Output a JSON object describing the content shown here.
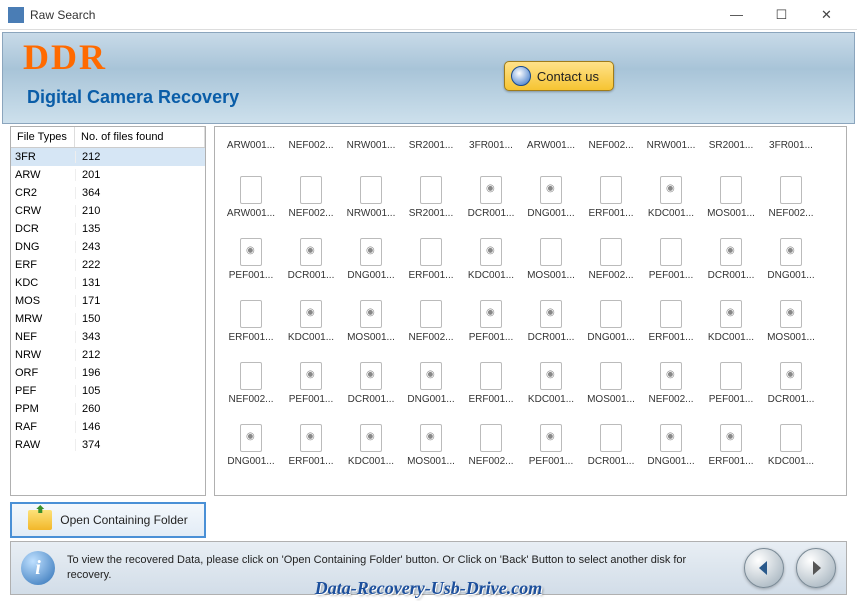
{
  "window": {
    "title": "Raw Search"
  },
  "header": {
    "logo": "DDR",
    "subtitle": "Digital Camera Recovery",
    "contact_label": "Contact us"
  },
  "left": {
    "col1": "File Types",
    "col2": "No. of files found",
    "rows": [
      {
        "t": "3FR",
        "n": "212"
      },
      {
        "t": "ARW",
        "n": "201"
      },
      {
        "t": "CR2",
        "n": "364"
      },
      {
        "t": "CRW",
        "n": "210"
      },
      {
        "t": "DCR",
        "n": "135"
      },
      {
        "t": "DNG",
        "n": "243"
      },
      {
        "t": "ERF",
        "n": "222"
      },
      {
        "t": "KDC",
        "n": "131"
      },
      {
        "t": "MOS",
        "n": "171"
      },
      {
        "t": "MRW",
        "n": "150"
      },
      {
        "t": "NEF",
        "n": "343"
      },
      {
        "t": "NRW",
        "n": "212"
      },
      {
        "t": "ORF",
        "n": "196"
      },
      {
        "t": "PEF",
        "n": "105"
      },
      {
        "t": "PPM",
        "n": "260"
      },
      {
        "t": "RAF",
        "n": "146"
      },
      {
        "t": "RAW",
        "n": "374"
      }
    ],
    "open_label": "Open Containing Folder"
  },
  "grid": {
    "row0": [
      "ARW001...",
      "NEF002...",
      "NRW001...",
      "SR2001...",
      "3FR001...",
      "ARW001...",
      "NEF002...",
      "NRW001...",
      "SR2001...",
      "3FR001..."
    ],
    "rows": [
      [
        {
          "n": "ARW001...",
          "g": 0
        },
        {
          "n": "NEF002...",
          "g": 0
        },
        {
          "n": "NRW001...",
          "g": 0
        },
        {
          "n": "SR2001...",
          "g": 0
        },
        {
          "n": "DCR001...",
          "g": 1
        },
        {
          "n": "DNG001...",
          "g": 1
        },
        {
          "n": "ERF001...",
          "g": 0
        },
        {
          "n": "KDC001...",
          "g": 1
        },
        {
          "n": "MOS001...",
          "g": 0
        },
        {
          "n": "NEF002...",
          "g": 0
        }
      ],
      [
        {
          "n": "PEF001...",
          "g": 1
        },
        {
          "n": "DCR001...",
          "g": 1
        },
        {
          "n": "DNG001...",
          "g": 1
        },
        {
          "n": "ERF001...",
          "g": 0
        },
        {
          "n": "KDC001...",
          "g": 1
        },
        {
          "n": "MOS001...",
          "g": 0
        },
        {
          "n": "NEF002...",
          "g": 0
        },
        {
          "n": "PEF001...",
          "g": 0
        },
        {
          "n": "DCR001...",
          "g": 1
        },
        {
          "n": "DNG001...",
          "g": 1
        }
      ],
      [
        {
          "n": "ERF001...",
          "g": 0
        },
        {
          "n": "KDC001...",
          "g": 1
        },
        {
          "n": "MOS001...",
          "g": 1
        },
        {
          "n": "NEF002...",
          "g": 0
        },
        {
          "n": "PEF001...",
          "g": 1
        },
        {
          "n": "DCR001...",
          "g": 1
        },
        {
          "n": "DNG001...",
          "g": 0
        },
        {
          "n": "ERF001...",
          "g": 0
        },
        {
          "n": "KDC001...",
          "g": 1
        },
        {
          "n": "MOS001...",
          "g": 1
        }
      ],
      [
        {
          "n": "NEF002...",
          "g": 0
        },
        {
          "n": "PEF001...",
          "g": 1
        },
        {
          "n": "DCR001...",
          "g": 1
        },
        {
          "n": "DNG001...",
          "g": 1
        },
        {
          "n": "ERF001...",
          "g": 0
        },
        {
          "n": "KDC001...",
          "g": 1
        },
        {
          "n": "MOS001...",
          "g": 0
        },
        {
          "n": "NEF002...",
          "g": 1
        },
        {
          "n": "PEF001...",
          "g": 0
        },
        {
          "n": "DCR001...",
          "g": 1
        }
      ],
      [
        {
          "n": "DNG001...",
          "g": 1
        },
        {
          "n": "ERF001...",
          "g": 1
        },
        {
          "n": "KDC001...",
          "g": 1
        },
        {
          "n": "MOS001...",
          "g": 1
        },
        {
          "n": "NEF002...",
          "g": 0
        },
        {
          "n": "PEF001...",
          "g": 1
        },
        {
          "n": "DCR001...",
          "g": 0
        },
        {
          "n": "DNG001...",
          "g": 1
        },
        {
          "n": "ERF001...",
          "g": 1
        },
        {
          "n": "KDC001...",
          "g": 0
        }
      ]
    ]
  },
  "footer": {
    "text": "To view the recovered Data, please click on 'Open Containing Folder' button. Or Click on 'Back' Button to select another disk for recovery."
  },
  "watermark": "Data-Recovery-Usb-Drive.com"
}
